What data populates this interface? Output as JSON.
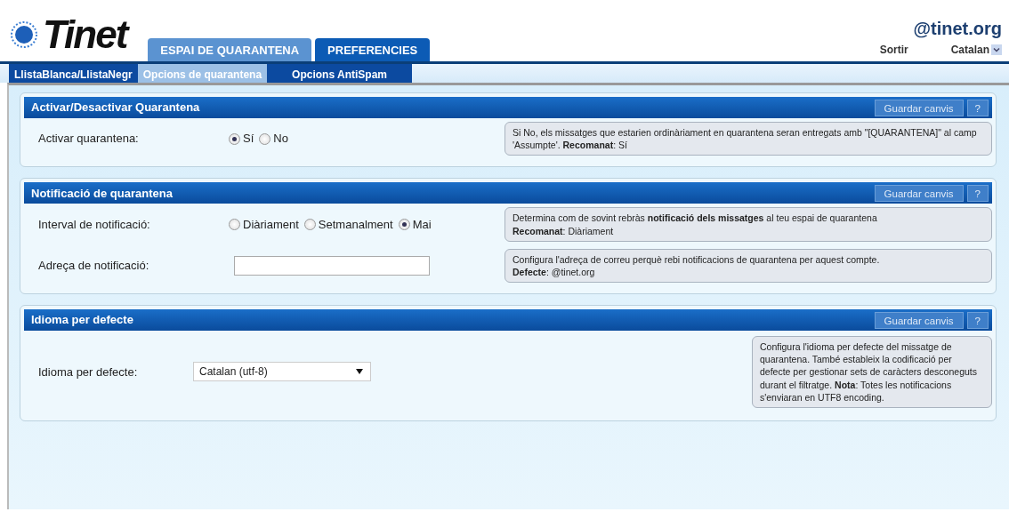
{
  "logo": {
    "text": "Tinet"
  },
  "main_tabs": [
    {
      "label": "ESPAI DE QUARANTENA",
      "selected": false
    },
    {
      "label": "PREFERENCIES",
      "selected": true
    }
  ],
  "account": {
    "domain": "@tinet.org",
    "logout": "Sortir",
    "language": "Catalan"
  },
  "sub_tabs": [
    {
      "label": "LlistaBlanca/LlistaNegr",
      "selected": false
    },
    {
      "label": "Opcions de quarantena",
      "selected": true
    },
    {
      "label": "Opcions AntiSpam",
      "selected": false
    }
  ],
  "sections": [
    {
      "title": "Activar/Desactivar Quarantena",
      "save_button": "Guardar canvis",
      "help_button": "?",
      "rows": [
        {
          "label": "Activar quarantena:",
          "kind": "radio",
          "options": [
            {
              "label": "Sí",
              "selected": true
            },
            {
              "label": "No",
              "selected": false
            }
          ],
          "help": [
            "Si No, els missatges que estarien ordinàriament en quarantena seran entregats amb \"[QUARANTENA]\" al camp 'Assumpte'. **Recomanat**: Sí"
          ]
        }
      ]
    },
    {
      "title": "Notificació de quarantena",
      "save_button": "Guardar canvis",
      "help_button": "?",
      "rows": [
        {
          "label": "Interval de notificació:",
          "kind": "radio",
          "options": [
            {
              "label": "Diàriament",
              "selected": false
            },
            {
              "label": "Setmanalment",
              "selected": false
            },
            {
              "label": "Mai",
              "selected": true
            }
          ],
          "help": [
            "Determina com de sovint rebràs **notificació dels missatges** al teu espai de quarantena",
            "**Recomanat**: Diàriament"
          ]
        },
        {
          "label": "Adreça de notificació:",
          "kind": "text",
          "help": [
            "Configura l'adreça de correu perquè rebi notificacions de quarantena per aquest compte.",
            "**Defecte**: @tinet.org"
          ]
        }
      ]
    },
    {
      "title": "Idioma per defecte",
      "save_button": "Guardar canvis",
      "help_button": "?",
      "rows": [
        {
          "label": "Idioma per defecte:",
          "kind": "select",
          "value": "Catalan (utf-8)",
          "help": [
            "Configura l'idioma per defecte del missatge de quarantena. També estableix la codificació per defecte per gestionar sets de caràcters desconeguts durant el filtratge. **Nota**: Totes les notificacions s'enviaran en UTF8 encoding."
          ]
        }
      ]
    }
  ]
}
